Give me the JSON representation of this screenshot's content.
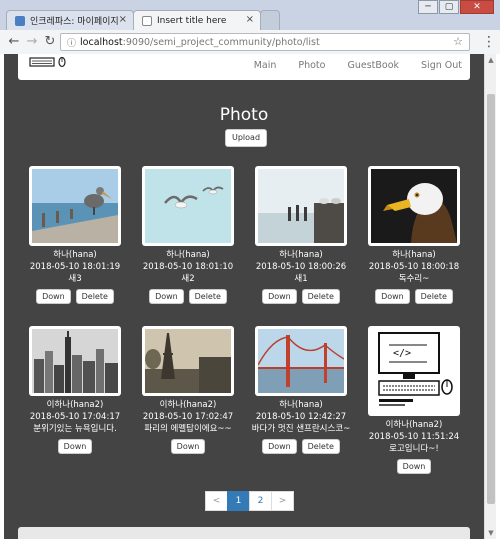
{
  "browser": {
    "tabs": [
      {
        "title": "인크레파스: 마이페이지",
        "active": false
      },
      {
        "title": "Insert title here",
        "active": true
      }
    ],
    "url_host": "localhost",
    "url_path": ":9090/semi_project_community/photo/list",
    "window_buttons": {
      "minimize": "─",
      "maximize": "▢",
      "close": "✕"
    },
    "tab_close": "×",
    "nav": {
      "back": "←",
      "forward": "→",
      "reload": "↻",
      "info": "ⓘ",
      "star": "☆",
      "menu": "⋮"
    }
  },
  "navbar": {
    "links": [
      "Main",
      "Photo",
      "GuestBook",
      "Sign Out"
    ]
  },
  "page": {
    "heading": "Photo",
    "upload_label": "Upload"
  },
  "photos": [
    {
      "author": "하나(hana)",
      "date": "2018-05-10 18:01:19",
      "caption": "새3",
      "buttons": [
        "Down",
        "Delete"
      ],
      "image": "pelican-pier"
    },
    {
      "author": "하나(hana)",
      "date": "2018-05-10 18:01:10",
      "caption": "새2",
      "buttons": [
        "Down",
        "Delete"
      ],
      "image": "seagulls-sky"
    },
    {
      "author": "하나(hana)",
      "date": "2018-05-10 18:00:26",
      "caption": "새1",
      "buttons": [
        "Down",
        "Delete"
      ],
      "image": "birds-on-posts"
    },
    {
      "author": "하나(hana)",
      "date": "2018-05-10 18:00:18",
      "caption": "독수리~",
      "buttons": [
        "Down",
        "Delete"
      ],
      "image": "eagle-head"
    },
    {
      "author": "이하나(hana2)",
      "date": "2018-05-10 17:04:17",
      "caption": "분위기있는 뉴욕입니다.",
      "buttons": [
        "Down"
      ],
      "image": "new-york-skyline"
    },
    {
      "author": "이하나(hana2)",
      "date": "2018-05-10 17:02:47",
      "caption": "파리의 에펠탑이에요~~",
      "buttons": [
        "Down"
      ],
      "image": "eiffel-tower"
    },
    {
      "author": "하나(hana)",
      "date": "2018-05-10 12:42:27",
      "caption": "바다가 멋진 샌프란시스코~",
      "buttons": [
        "Down",
        "Delete"
      ],
      "image": "golden-gate-bridge"
    },
    {
      "author": "이하나(hana2)",
      "date": "2018-05-10 11:51:24",
      "caption": "로고입니다~!",
      "buttons": [
        "Down"
      ],
      "image": "computer-logo"
    }
  ],
  "pagination": {
    "prev": "<",
    "pages": [
      "1",
      "2"
    ],
    "next": ">",
    "current": "1"
  },
  "colors": {
    "page_bg": "#444444",
    "accent": "#337ab7"
  }
}
